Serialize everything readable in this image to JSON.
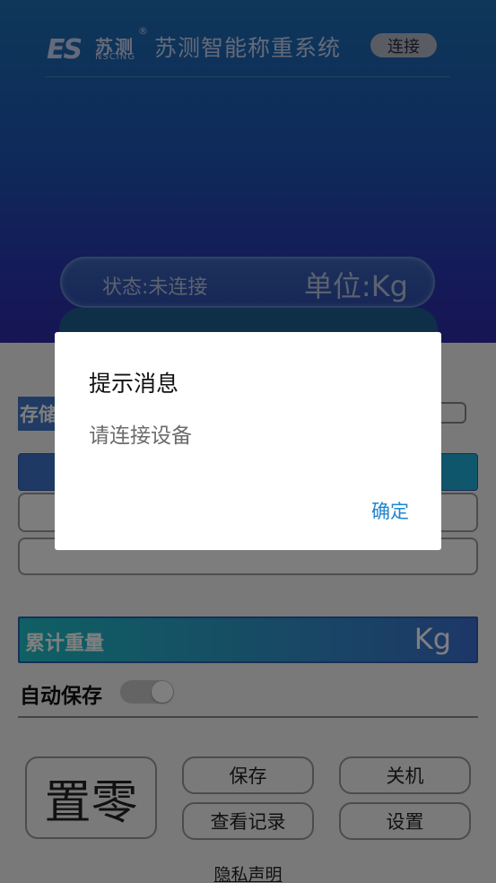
{
  "header": {
    "logo": {
      "mark": "ES",
      "cn": "苏测",
      "en": "NSCING",
      "reg": "®"
    },
    "title": "苏测智能称重系统",
    "connect_label": "连接",
    "status": "状态:未连接",
    "unit": "单位:Kg"
  },
  "panel": {
    "store_label": "存储",
    "total_label": "累计重量",
    "total_unit": "Kg",
    "autosave_label": "自动保存",
    "autosave_on": false
  },
  "buttons": {
    "zero": "置零",
    "save": "保存",
    "shutdown": "关机",
    "records": "查看记录",
    "settings": "设置",
    "privacy": "隐私声明"
  },
  "dialog": {
    "title": "提示消息",
    "message": "请连接设备",
    "ok_label": "确定"
  },
  "colors": {
    "header_top": "#1c6fb3",
    "header_bottom": "#2e2aa8",
    "dialog_ok": "#1f86d0"
  }
}
